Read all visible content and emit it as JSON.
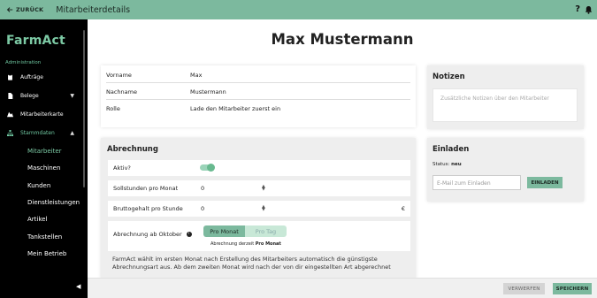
{
  "topbar": {
    "back_label": "ZURÜCK",
    "title": "Mitarbeiterdetails",
    "help_icon": "question-mark-icon",
    "bell_icon": "bell-icon"
  },
  "sidebar": {
    "logo": "FarmAct",
    "section": "Administration",
    "items": [
      {
        "label": "Aufträge",
        "icon": "clipboard-icon"
      },
      {
        "label": "Belege",
        "icon": "document-icon",
        "chevron": "▼"
      },
      {
        "label": "Mitarbeiterkarte",
        "icon": "map-icon"
      },
      {
        "label": "Stammdaten",
        "icon": "hierarchy-icon",
        "chevron": "▲"
      }
    ],
    "subitems": [
      "Mitarbeiter",
      "Maschinen",
      "Kunden",
      "Dienstleistungen",
      "Artikel",
      "Tankstellen",
      "Mein Betrieb"
    ],
    "collapse_glyph": "◀"
  },
  "employee": {
    "name": "Max Mustermann"
  },
  "info": {
    "rows": [
      {
        "label": "Vorname",
        "value": "Max"
      },
      {
        "label": "Nachname",
        "value": "Mustermann"
      },
      {
        "label": "Rolle",
        "value": "Lade den Mitarbeiter zuerst ein"
      }
    ]
  },
  "billing": {
    "title": "Abrechnung",
    "active_label": "Aktiv?",
    "active": true,
    "target_hours_label": "Sollstunden pro Monat",
    "target_hours_value": "0",
    "gross_label": "Bruttogehalt pro Stunde",
    "gross_value": "0",
    "currency": "€",
    "billing_from_label": "Abrechnung ab Oktober",
    "info_glyph": "i",
    "per_month_label": "Pro Monat",
    "per_day_label": "Pro Tag",
    "current_prefix": "Abrechnung derzeit",
    "current_value": "Pro Monat",
    "note": "FarmAct wählt im ersten Monat nach Erstellung des Mitarbeiters automatisch die günstigste Abrechnungsart aus. Ab dem zweiten Monat wird nach der von dir eingestellten Art abgerechnet"
  },
  "notes": {
    "title": "Notizen",
    "placeholder": "Zusätzliche Notizen über den Mitarbeiter"
  },
  "invite": {
    "title": "Einladen",
    "status_label": "Status:",
    "status_value": "neu",
    "email_placeholder": "E-Mail zum Einladen",
    "button": "EINLADEN"
  },
  "footer": {
    "discard": "VERWERFEN",
    "save": "SPEICHERN"
  },
  "colors": {
    "accent": "#7cb99e",
    "sidebar_bg": "#000000",
    "active_text": "#6ec59f"
  }
}
